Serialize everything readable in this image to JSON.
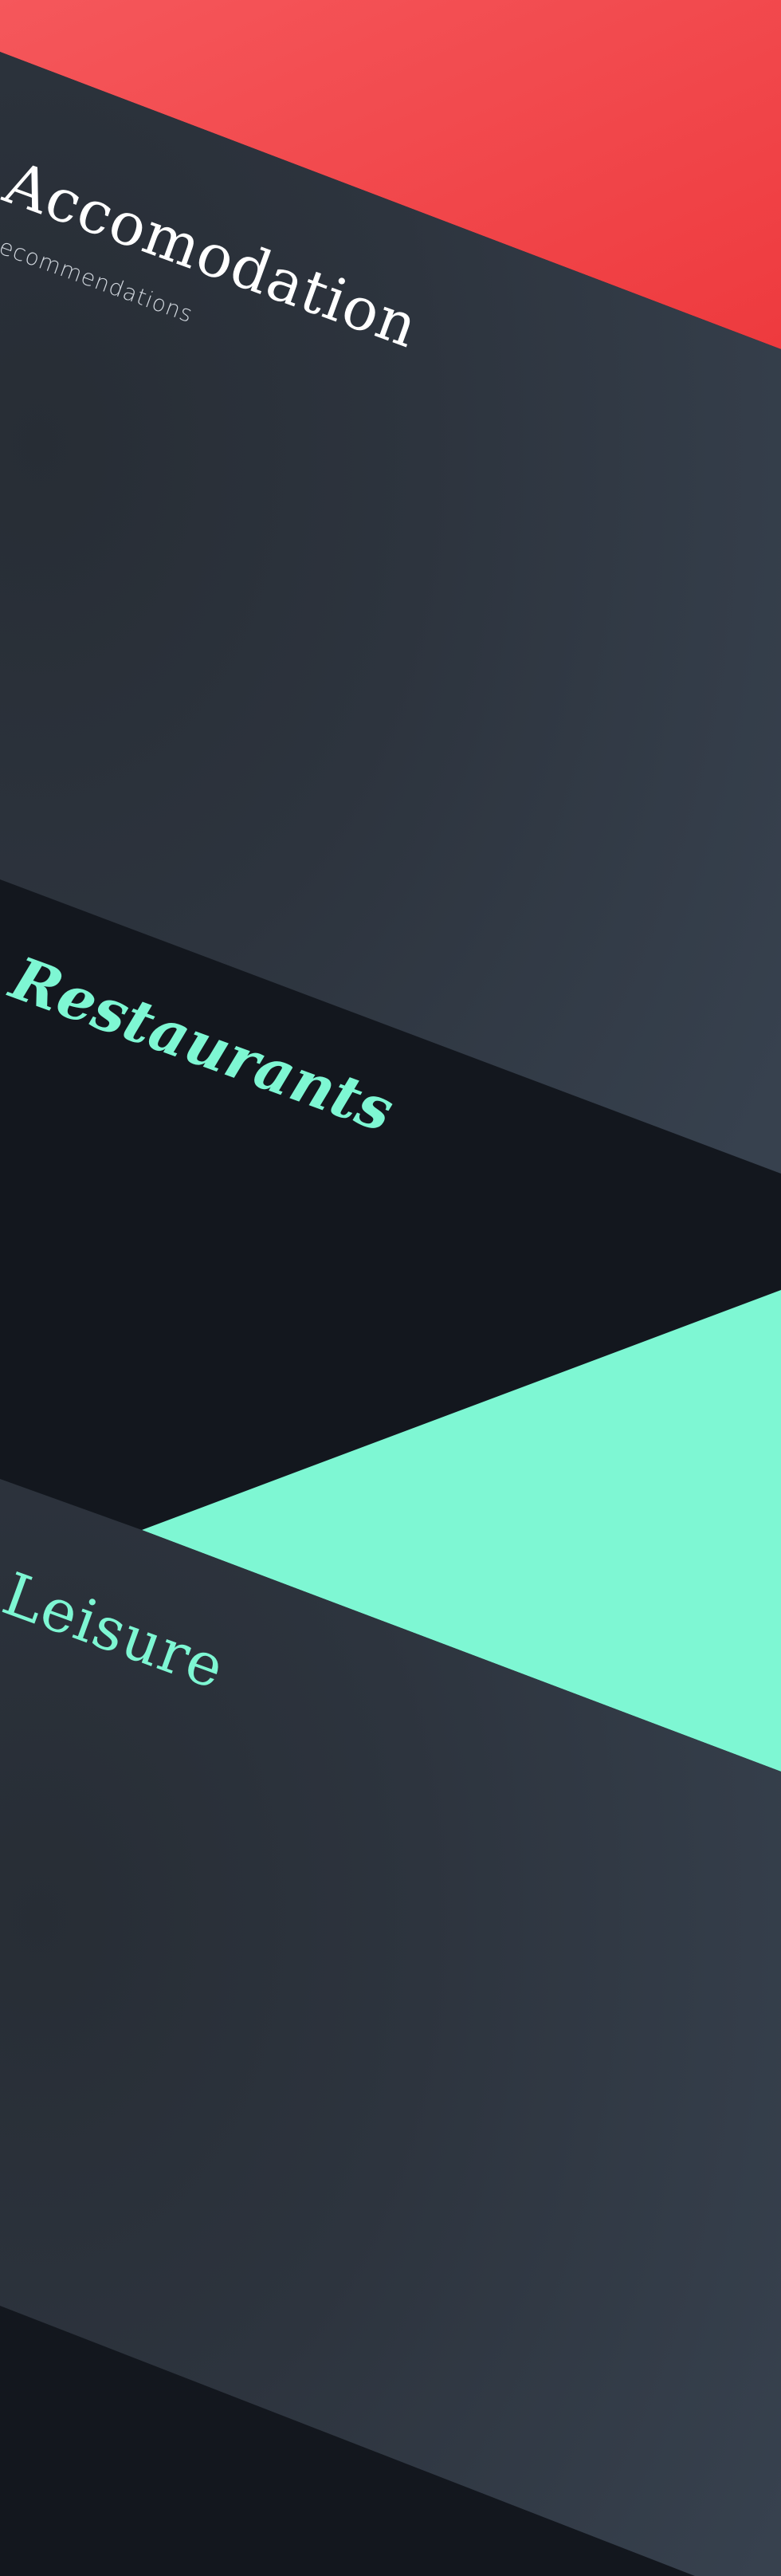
{
  "colors": {
    "red_banner": "#f0484c",
    "slate_panel": "#2f3742",
    "dark_band": "#13171e",
    "mint_accent": "#7ef7d3"
  },
  "sections": {
    "accommodation": {
      "title": "Accomodation",
      "subtitle": "Recommendations"
    },
    "restaurants": {
      "title": "Restaurants"
    },
    "leisure": {
      "title": "Leisure"
    }
  }
}
